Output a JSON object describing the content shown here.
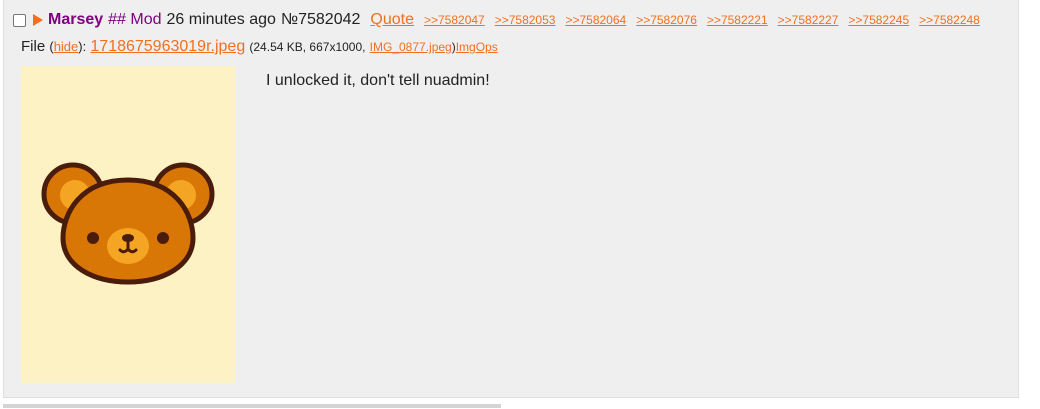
{
  "post": {
    "name": "Marsey",
    "capcode": "## Mod",
    "time": "26 minutes ago",
    "number": "№7582042",
    "quote_label": "Quote",
    "backlinks": [
      ">>7582047",
      ">>7582053",
      ">>7582064",
      ">>7582076",
      ">>7582221",
      ">>7582227",
      ">>7582245",
      ">>7582248"
    ],
    "file": {
      "prefix": "File",
      "open_paren": "(",
      "hide_label": "hide",
      "close_paren_colon": "):",
      "filename": "1718675963019r.jpeg",
      "meta_prefix": "(24.54 KB, 667x1000,",
      "original_name": "IMG_0877.jpeg",
      "meta_suffix": ")",
      "imgops_label": "ImgOps"
    },
    "message": "I unlocked it, don't tell nuadmin!"
  },
  "icons": {
    "checkbox": "checkbox-icon",
    "collapse": "triangle-right-icon",
    "thumbnail": "bear-face-image"
  },
  "colors": {
    "link": "#f07020",
    "name": "#800080",
    "post_bg": "#efefef",
    "thumb_bg": "#fdf2c4"
  }
}
